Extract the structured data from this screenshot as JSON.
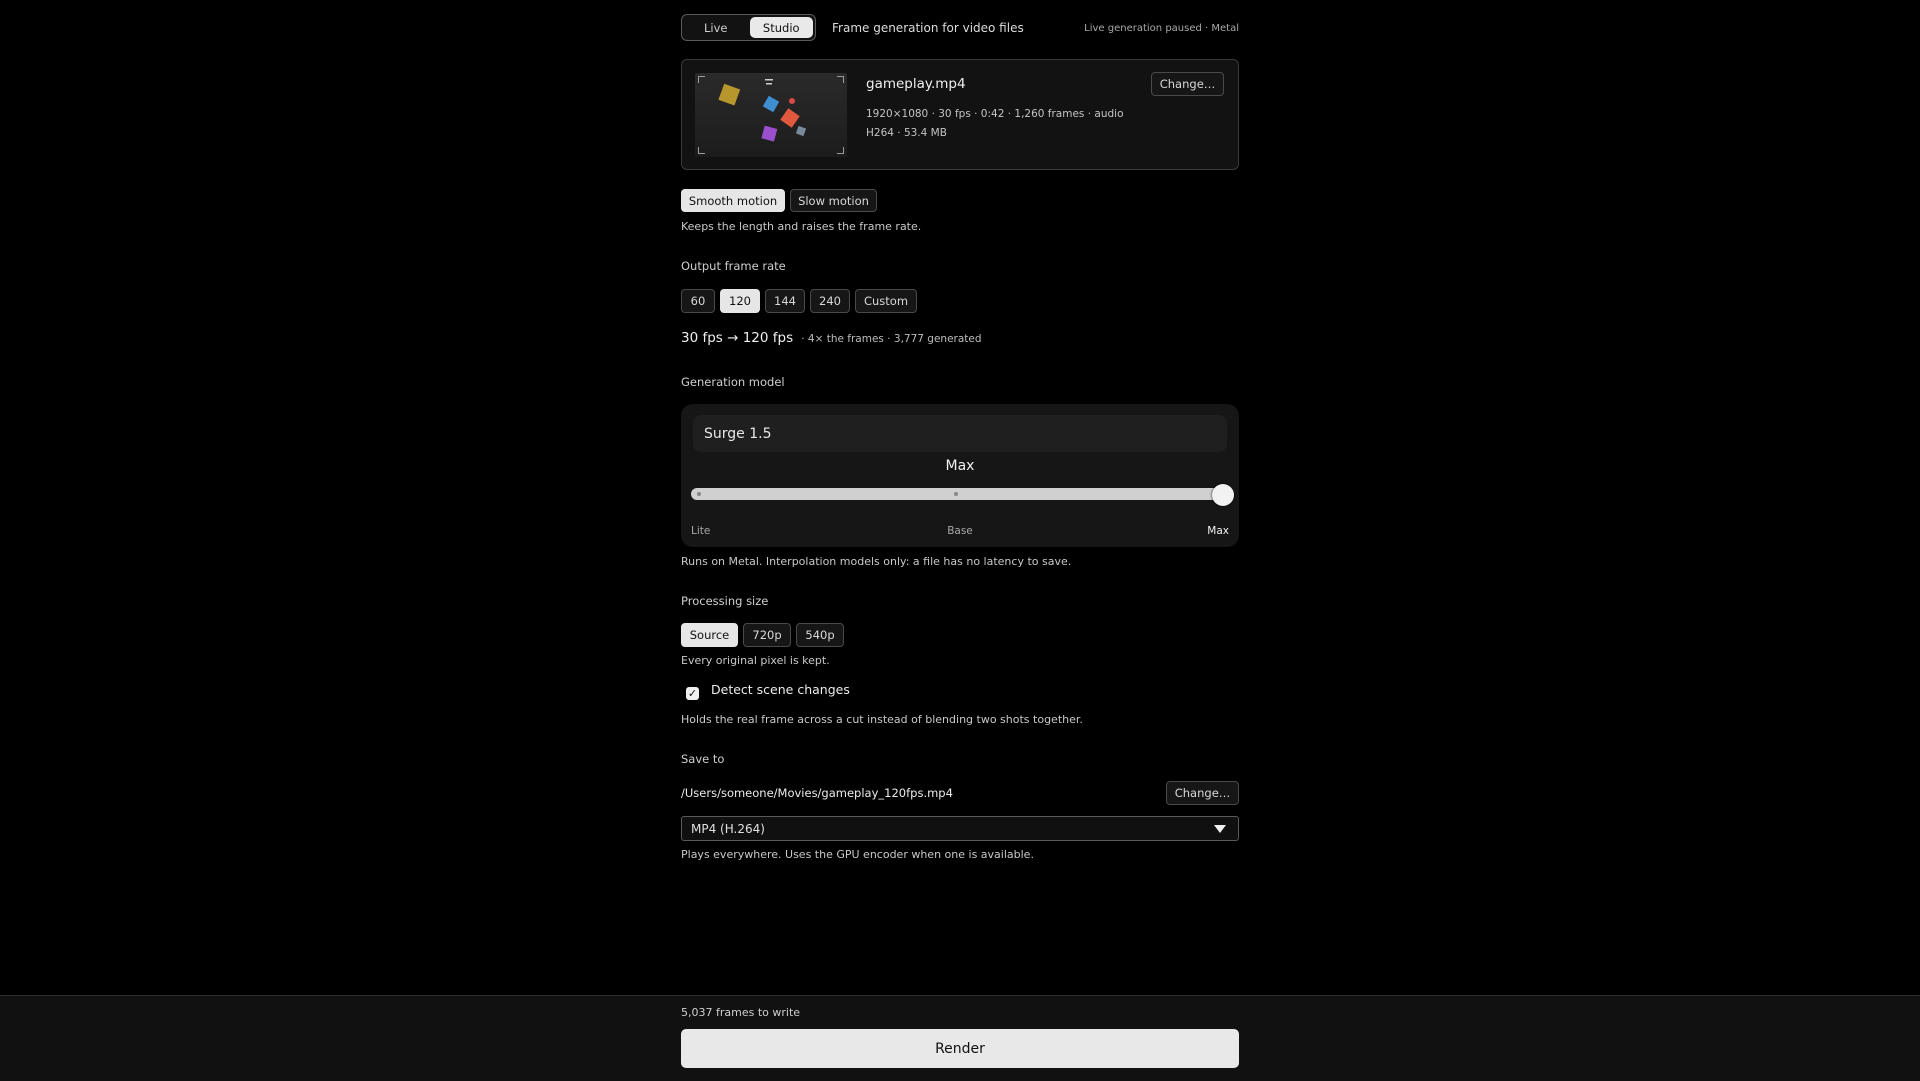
{
  "mode": {
    "tabs": [
      "Live",
      "Studio"
    ],
    "selected": "Studio",
    "description": "Frame generation for video files"
  },
  "status": "Live generation paused · Metal",
  "file": {
    "name": "gameplay.mp4",
    "meta1": "1920×1080 · 30 fps · 0:42 · 1,260 frames · audio",
    "meta2": "H264 · 53.4 MB",
    "change_label": "Change…"
  },
  "motion": {
    "options": [
      "Smooth motion",
      "Slow motion"
    ],
    "selected": "Smooth motion",
    "hint": "Keeps the length and raises the frame rate."
  },
  "frame_rate": {
    "label": "Output frame rate",
    "options": [
      "60",
      "120",
      "144",
      "240",
      "Custom"
    ],
    "selected": "120",
    "summary_main": "30 fps → 120 fps",
    "summary_detail": "· 4× the frames · 3,777 generated"
  },
  "model": {
    "label": "Generation model",
    "name": "Surge 1.5",
    "quality_value": "Max",
    "quality_level": 1.0,
    "stops": [
      "Lite",
      "Base",
      "Max"
    ],
    "hint": "Runs on Metal. Interpolation models only: a file has no latency to save."
  },
  "processing": {
    "label": "Processing size",
    "options": [
      "Source",
      "720p",
      "540p"
    ],
    "selected": "Source",
    "hint": "Every original pixel is kept."
  },
  "scene_detect": {
    "label": "Detect scene changes",
    "checked": true,
    "hint": "Holds the real frame across a cut instead of blending two shots together."
  },
  "save": {
    "label": "Save to",
    "path": "/Users/someone/Movies/gameplay_120fps.mp4",
    "change_label": "Change…",
    "format": "MP4 (H.264)",
    "format_hint": "Plays everywhere. Uses the GPU encoder when one is available."
  },
  "footer": {
    "frames_to_write": "5,037 frames to write",
    "render_label": "Render"
  },
  "icons": {
    "check": "check-icon",
    "dropdown": "chevron-down-icon"
  }
}
